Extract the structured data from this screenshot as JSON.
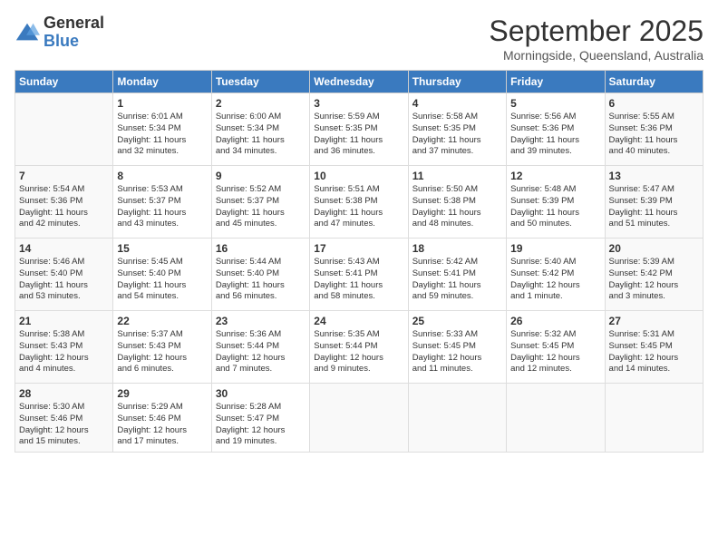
{
  "header": {
    "logo_general": "General",
    "logo_blue": "Blue",
    "month": "September 2025",
    "location": "Morningside, Queensland, Australia"
  },
  "days": [
    "Sunday",
    "Monday",
    "Tuesday",
    "Wednesday",
    "Thursday",
    "Friday",
    "Saturday"
  ],
  "weeks": [
    [
      {
        "day": "",
        "info": ""
      },
      {
        "day": "1",
        "info": "Sunrise: 6:01 AM\nSunset: 5:34 PM\nDaylight: 11 hours\nand 32 minutes."
      },
      {
        "day": "2",
        "info": "Sunrise: 6:00 AM\nSunset: 5:34 PM\nDaylight: 11 hours\nand 34 minutes."
      },
      {
        "day": "3",
        "info": "Sunrise: 5:59 AM\nSunset: 5:35 PM\nDaylight: 11 hours\nand 36 minutes."
      },
      {
        "day": "4",
        "info": "Sunrise: 5:58 AM\nSunset: 5:35 PM\nDaylight: 11 hours\nand 37 minutes."
      },
      {
        "day": "5",
        "info": "Sunrise: 5:56 AM\nSunset: 5:36 PM\nDaylight: 11 hours\nand 39 minutes."
      },
      {
        "day": "6",
        "info": "Sunrise: 5:55 AM\nSunset: 5:36 PM\nDaylight: 11 hours\nand 40 minutes."
      }
    ],
    [
      {
        "day": "7",
        "info": "Sunrise: 5:54 AM\nSunset: 5:36 PM\nDaylight: 11 hours\nand 42 minutes."
      },
      {
        "day": "8",
        "info": "Sunrise: 5:53 AM\nSunset: 5:37 PM\nDaylight: 11 hours\nand 43 minutes."
      },
      {
        "day": "9",
        "info": "Sunrise: 5:52 AM\nSunset: 5:37 PM\nDaylight: 11 hours\nand 45 minutes."
      },
      {
        "day": "10",
        "info": "Sunrise: 5:51 AM\nSunset: 5:38 PM\nDaylight: 11 hours\nand 47 minutes."
      },
      {
        "day": "11",
        "info": "Sunrise: 5:50 AM\nSunset: 5:38 PM\nDaylight: 11 hours\nand 48 minutes."
      },
      {
        "day": "12",
        "info": "Sunrise: 5:48 AM\nSunset: 5:39 PM\nDaylight: 11 hours\nand 50 minutes."
      },
      {
        "day": "13",
        "info": "Sunrise: 5:47 AM\nSunset: 5:39 PM\nDaylight: 11 hours\nand 51 minutes."
      }
    ],
    [
      {
        "day": "14",
        "info": "Sunrise: 5:46 AM\nSunset: 5:40 PM\nDaylight: 11 hours\nand 53 minutes."
      },
      {
        "day": "15",
        "info": "Sunrise: 5:45 AM\nSunset: 5:40 PM\nDaylight: 11 hours\nand 54 minutes."
      },
      {
        "day": "16",
        "info": "Sunrise: 5:44 AM\nSunset: 5:40 PM\nDaylight: 11 hours\nand 56 minutes."
      },
      {
        "day": "17",
        "info": "Sunrise: 5:43 AM\nSunset: 5:41 PM\nDaylight: 11 hours\nand 58 minutes."
      },
      {
        "day": "18",
        "info": "Sunrise: 5:42 AM\nSunset: 5:41 PM\nDaylight: 11 hours\nand 59 minutes."
      },
      {
        "day": "19",
        "info": "Sunrise: 5:40 AM\nSunset: 5:42 PM\nDaylight: 12 hours\nand 1 minute."
      },
      {
        "day": "20",
        "info": "Sunrise: 5:39 AM\nSunset: 5:42 PM\nDaylight: 12 hours\nand 3 minutes."
      }
    ],
    [
      {
        "day": "21",
        "info": "Sunrise: 5:38 AM\nSunset: 5:43 PM\nDaylight: 12 hours\nand 4 minutes."
      },
      {
        "day": "22",
        "info": "Sunrise: 5:37 AM\nSunset: 5:43 PM\nDaylight: 12 hours\nand 6 minutes."
      },
      {
        "day": "23",
        "info": "Sunrise: 5:36 AM\nSunset: 5:44 PM\nDaylight: 12 hours\nand 7 minutes."
      },
      {
        "day": "24",
        "info": "Sunrise: 5:35 AM\nSunset: 5:44 PM\nDaylight: 12 hours\nand 9 minutes."
      },
      {
        "day": "25",
        "info": "Sunrise: 5:33 AM\nSunset: 5:45 PM\nDaylight: 12 hours\nand 11 minutes."
      },
      {
        "day": "26",
        "info": "Sunrise: 5:32 AM\nSunset: 5:45 PM\nDaylight: 12 hours\nand 12 minutes."
      },
      {
        "day": "27",
        "info": "Sunrise: 5:31 AM\nSunset: 5:45 PM\nDaylight: 12 hours\nand 14 minutes."
      }
    ],
    [
      {
        "day": "28",
        "info": "Sunrise: 5:30 AM\nSunset: 5:46 PM\nDaylight: 12 hours\nand 15 minutes."
      },
      {
        "day": "29",
        "info": "Sunrise: 5:29 AM\nSunset: 5:46 PM\nDaylight: 12 hours\nand 17 minutes."
      },
      {
        "day": "30",
        "info": "Sunrise: 5:28 AM\nSunset: 5:47 PM\nDaylight: 12 hours\nand 19 minutes."
      },
      {
        "day": "",
        "info": ""
      },
      {
        "day": "",
        "info": ""
      },
      {
        "day": "",
        "info": ""
      },
      {
        "day": "",
        "info": ""
      }
    ]
  ]
}
